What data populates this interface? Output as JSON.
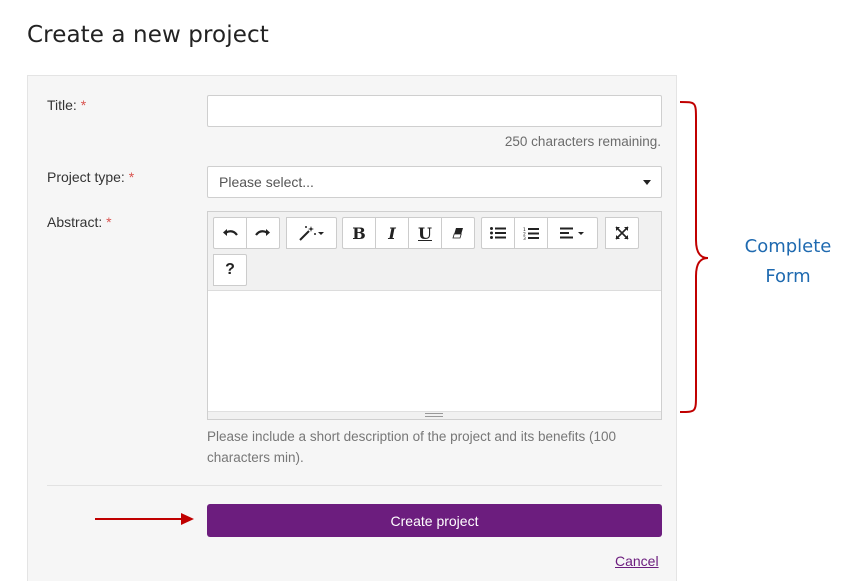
{
  "page": {
    "title": "Create a new project"
  },
  "form": {
    "title_label": "Title:",
    "required_mark": "*",
    "title_value": "",
    "chars_remaining": "250 characters remaining.",
    "project_type_label": "Project type:",
    "project_type_selected": "Please select...",
    "abstract_label": "Abstract:",
    "abstract_help": "Please include a short description of the project and its benefits (100 characters min).",
    "submit_label": "Create project",
    "cancel_label": "Cancel"
  },
  "toolbar": {
    "groups": [
      [
        "undo-icon",
        "redo-icon"
      ],
      [
        "magic-wand-icon"
      ],
      [
        "bold-icon",
        "italic-icon",
        "underline-icon",
        "eraser-icon"
      ],
      [
        "unordered-list-icon",
        "ordered-list-icon",
        "align-icon"
      ],
      [
        "fullscreen-icon"
      ],
      [
        "help-icon"
      ]
    ],
    "bold_glyph": "B",
    "italic_glyph": "I",
    "underline_glyph": "U",
    "help_glyph": "?"
  },
  "annotation": {
    "text": "Complete Form",
    "brace_color": "#c00000",
    "text_color": "#1f6ab0",
    "arrow_color": "#c00000"
  },
  "colors": {
    "accent": "#6c1d7e",
    "required": "#d9534f"
  }
}
